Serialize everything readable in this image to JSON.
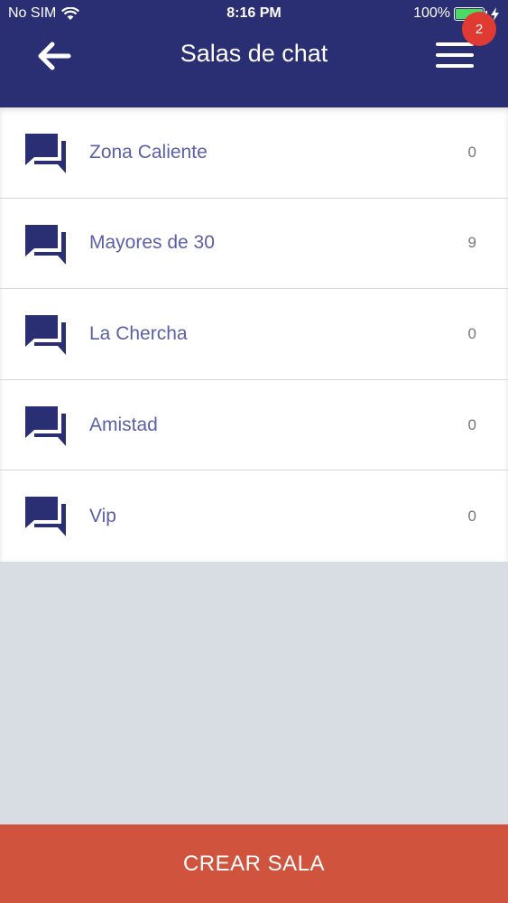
{
  "status_bar": {
    "carrier": "No SIM",
    "time": "8:16 PM",
    "battery": "100%",
    "battery_level": 1.0
  },
  "header": {
    "title": "Salas de chat",
    "notification_count": "2"
  },
  "rooms": [
    {
      "name": "Zona Caliente",
      "count": "0"
    },
    {
      "name": "Mayores de 30",
      "count": "9"
    },
    {
      "name": "La Chercha",
      "count": "0"
    },
    {
      "name": "Amistad",
      "count": "0"
    },
    {
      "name": "Vip",
      "count": "0"
    }
  ],
  "footer": {
    "create_label": "CREAR SALA"
  },
  "colors": {
    "header_bg": "#2a2e73",
    "accent_text": "#5b5fa8",
    "footer_bg": "#d0533e",
    "badge": "#e03b32"
  },
  "icons": {
    "back": "arrow-left-icon",
    "menu": "hamburger-menu-icon",
    "room": "chat-bubbles-icon",
    "wifi": "wifi-icon",
    "battery": "battery-icon",
    "charging": "charging-bolt-icon"
  }
}
